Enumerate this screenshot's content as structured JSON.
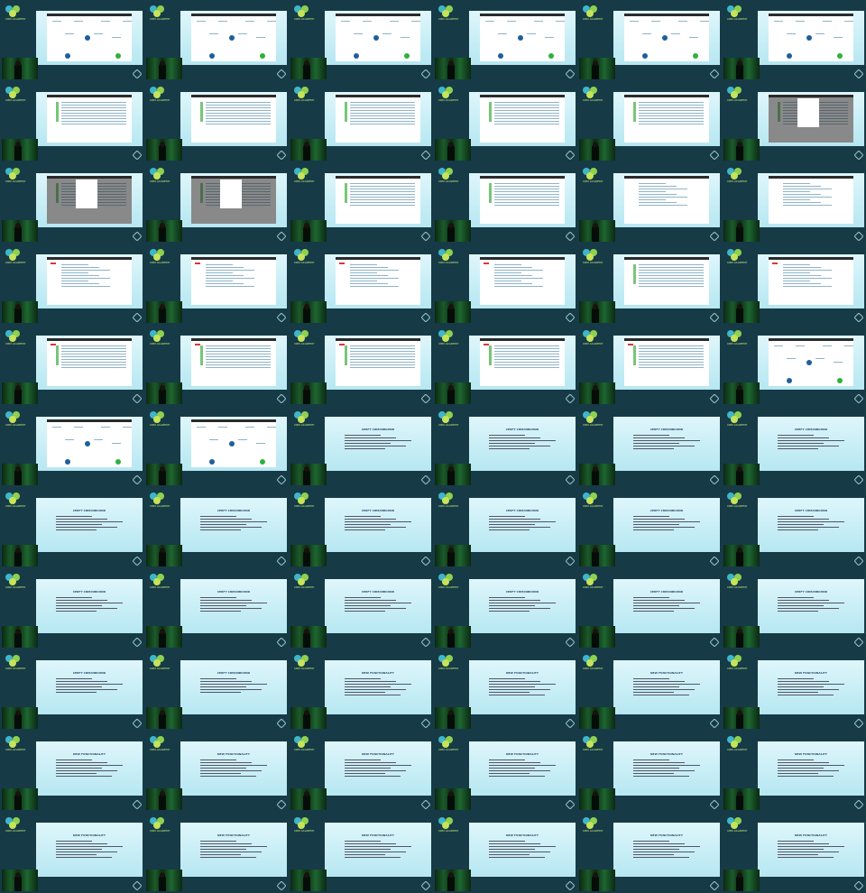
{
  "grid": {
    "rows": 11,
    "cols": 6
  },
  "brand": {
    "logo_text": "CRM ACADEMY",
    "logo_colors": [
      "#3fb6c9",
      "#8fd14f",
      "#c6e45a"
    ]
  },
  "slide_titles": {
    "crm": "CERFY CRM/INBOUND",
    "new": "NEW FUNCTIONALITY"
  },
  "cells": [
    "app-diagram",
    "app-diagram",
    "app-diagram",
    "app-diagram",
    "app-diagram",
    "app-diagram",
    "app-table",
    "app-table",
    "app-table",
    "app-table",
    "app-table",
    "app-table-dim",
    "app-table-dim",
    "app-table-dim",
    "app-table",
    "app-table",
    "app-form",
    "app-form",
    "app-form-red",
    "app-form-red",
    "app-form-red",
    "app-form-red",
    "app-table",
    "app-form-red",
    "app-table-red",
    "app-table-red",
    "app-table-red",
    "app-table-red",
    "app-table-red",
    "app-diagram",
    "app-diagram",
    "app-diagram",
    "text-crm",
    "text-crm",
    "text-crm",
    "text-crm",
    "text-crm",
    "text-crm",
    "text-crm",
    "text-crm",
    "text-crm",
    "text-crm",
    "text-crm",
    "text-crm",
    "text-crm",
    "text-crm",
    "text-crm",
    "text-crm",
    "text-crm",
    "text-crm",
    "text-new",
    "text-new",
    "text-new",
    "text-new",
    "text-new",
    "text-new",
    "text-new",
    "text-new",
    "text-new",
    "text-new",
    "text-new",
    "text-new",
    "text-new",
    "text-new",
    "text-new",
    "text-new"
  ],
  "accent": "#79c57a",
  "alert": "#d03a3a"
}
